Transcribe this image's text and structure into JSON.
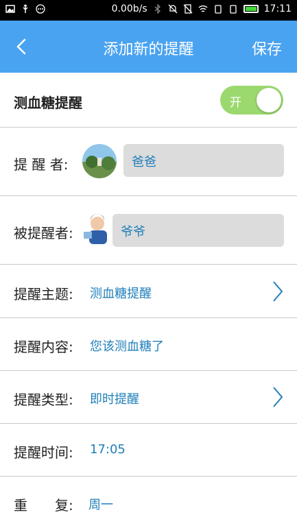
{
  "status_bar": {
    "speed": "0.00b/s",
    "time": "17:11",
    "colors": {
      "battery": "#45d83a"
    }
  },
  "header": {
    "title": "添加新的提醒",
    "save_label": "保存",
    "background": "#4aa3f0"
  },
  "toggle_row": {
    "label": "测血糖提醒",
    "toggle_text": "开",
    "enabled": true
  },
  "reminder_by": {
    "label": "提 醒 者:",
    "name": "爸爸"
  },
  "reminded": {
    "label": "被提醒者:",
    "name": "爷爷"
  },
  "fields": {
    "topic": {
      "label": "提醒主题:",
      "value": "测血糖提醒"
    },
    "content": {
      "label": "提醒内容:",
      "value": "您该测血糖了"
    },
    "type": {
      "label": "提醒类型:",
      "value": "即时提醒"
    },
    "time": {
      "label": "提醒时间:",
      "value": "17:05"
    },
    "repeat": {
      "label": "重　　复:",
      "value": "周一"
    }
  }
}
